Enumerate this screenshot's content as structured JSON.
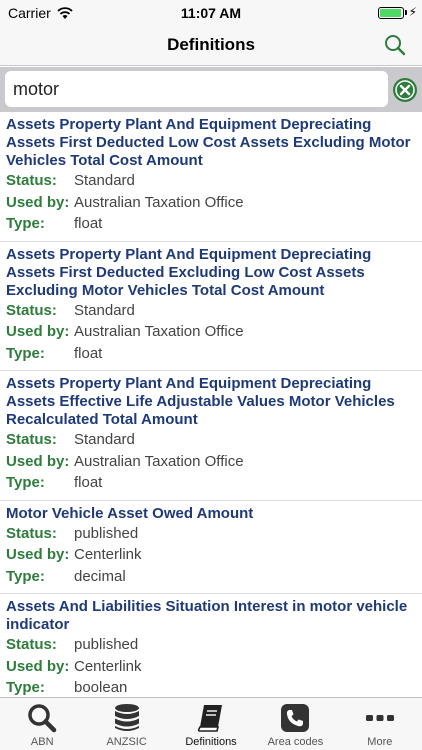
{
  "status_bar": {
    "carrier": "Carrier",
    "time": "11:07 AM"
  },
  "nav": {
    "title": "Definitions"
  },
  "search": {
    "value": "motor",
    "placeholder": ""
  },
  "labels": {
    "status": "Status:",
    "used_by": "Used by:",
    "type": "Type:"
  },
  "results": [
    {
      "name": "Assets Property Plant And Equipment Depreciating Assets First Deducted Low Cost Assets Excluding Motor Vehicles Total Cost Amount",
      "status": "Standard",
      "used_by": "Australian Taxation Office",
      "type": "float"
    },
    {
      "name": "Assets Property Plant And Equipment Depreciating Assets First Deducted Excluding Low Cost Assets Excluding Motor Vehicles Total Cost Amount",
      "status": "Standard",
      "used_by": "Australian Taxation Office",
      "type": "float"
    },
    {
      "name": "Assets Property Plant And Equipment Depreciating Assets Effective Life Adjustable Values Motor Vehicles Recalculated Total Amount",
      "status": "Standard",
      "used_by": "Australian Taxation Office",
      "type": "float"
    },
    {
      "name": "Motor Vehicle Asset Owed Amount",
      "status": "published",
      "used_by": "Centerlink",
      "type": "decimal"
    },
    {
      "name": "Assets And Liabilities Situation Interest in motor vehicle indicator",
      "status": "published",
      "used_by": "Centerlink",
      "type": "boolean"
    }
  ],
  "tabs": [
    {
      "label": "ABN",
      "icon": "search-icon"
    },
    {
      "label": "ANZSIC",
      "icon": "database-icon"
    },
    {
      "label": "Definitions",
      "icon": "book-icon",
      "active": true
    },
    {
      "label": "Area codes",
      "icon": "phone-icon"
    },
    {
      "label": "More",
      "icon": "more-icon"
    }
  ],
  "colors": {
    "title": "#1f3a78",
    "label": "#2e7d3c",
    "accent": "#2e7d3c"
  }
}
